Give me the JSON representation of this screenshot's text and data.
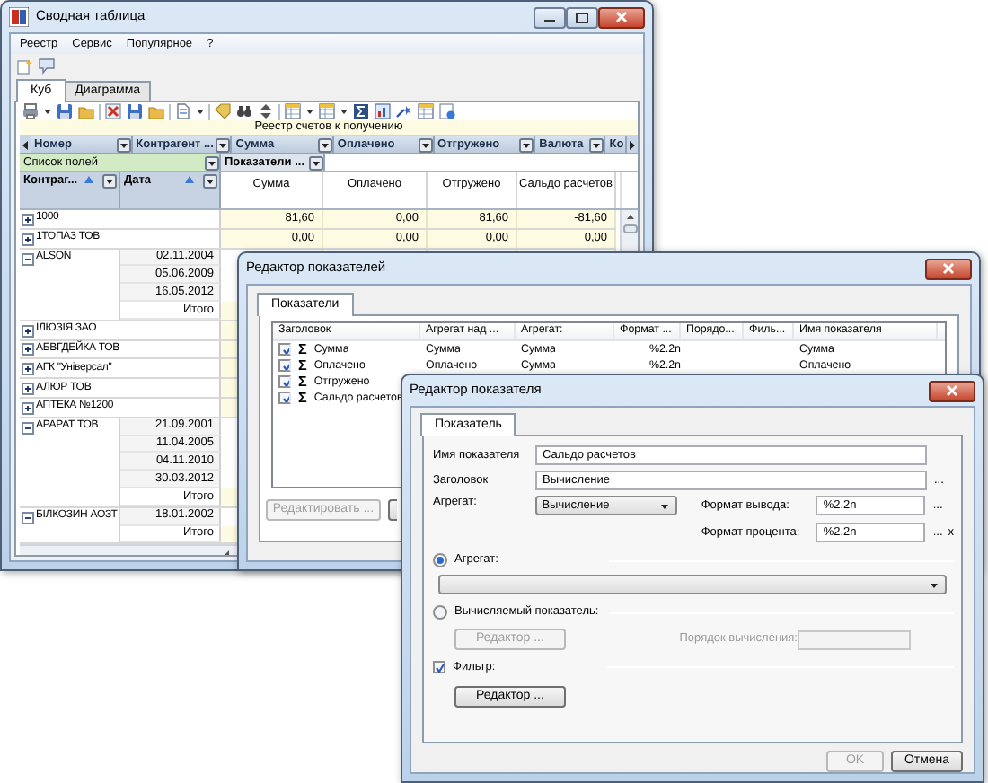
{
  "main_window": {
    "title": "Сводная таблица",
    "menu": [
      "Реестр",
      "Сервис",
      "Популярное",
      "?"
    ],
    "tabs": [
      {
        "label": "Куб",
        "selected": true
      },
      {
        "label": "Диаграмма",
        "selected": false
      }
    ],
    "pivot": {
      "banner": "Реестр счетов к получению",
      "column_fields": [
        "Номер",
        "Контрагент ...",
        "Сумма",
        "Оплачено",
        "Отгружено",
        "Валюта",
        "Ко"
      ],
      "field_list": "Список полей",
      "measures": "Показатели ...",
      "row_fields": [
        "Контраг...",
        "Дата"
      ],
      "columns": [
        "Сумма",
        "Оплачено",
        "Отгружено",
        "Сальдо расчетов"
      ],
      "rows": [
        {
          "label": "1000",
          "expanded": false,
          "values": [
            "81,60",
            "0,00",
            "81,60",
            "-81,60"
          ]
        },
        {
          "label": "1ТОПАЗ ТОВ",
          "expanded": false,
          "values": [
            "0,00",
            "0,00",
            "0,00",
            "0,00"
          ]
        },
        {
          "label": "ALSON",
          "expanded": true,
          "children": [
            {
              "label": "02.11.2004",
              "kind": "date"
            },
            {
              "label": "05.06.2009",
              "kind": "date"
            },
            {
              "label": "16.05.2012",
              "kind": "date"
            },
            {
              "label": "Итого",
              "kind": "total"
            }
          ]
        },
        {
          "label": "ІЛЮЗІЯ ЗАО",
          "expanded": false
        },
        {
          "label": "АБВГДЕЙКА ТОВ",
          "expanded": false
        },
        {
          "label": "АГК \"Універсал\"",
          "expanded": false
        },
        {
          "label": "АЛЮР ТОВ",
          "expanded": false
        },
        {
          "label": "АПТЕКА №1200",
          "expanded": false
        },
        {
          "label": "АРАРАТ ТОВ",
          "expanded": true,
          "children": [
            {
              "label": "21.09.2001",
              "kind": "date"
            },
            {
              "label": "11.04.2005",
              "kind": "date"
            },
            {
              "label": "04.11.2010",
              "kind": "date"
            },
            {
              "label": "30.03.2012",
              "kind": "date"
            },
            {
              "label": "Итого",
              "kind": "total"
            }
          ]
        },
        {
          "label": "БІЛКОЗИН АОЗТ",
          "expanded": true,
          "children": [
            {
              "label": "18.01.2002",
              "kind": "date"
            },
            {
              "label": "Итого",
              "kind": "total"
            }
          ]
        }
      ]
    }
  },
  "measures_editor": {
    "title": "Редактор показателей",
    "tabs": [
      {
        "label": "Показатели",
        "selected": true
      }
    ],
    "columns": [
      "Заголовок",
      "Агрегат над ...",
      "Агрегат:",
      "Формат ...",
      "Порядо...",
      "Филь...",
      "Имя показателя"
    ],
    "rows": [
      {
        "checked": true,
        "symbol": "Σ",
        "cells": [
          "Сумма",
          "Сумма",
          "Сумма",
          "%2.2n",
          "",
          "",
          "Сумма"
        ]
      },
      {
        "checked": true,
        "symbol": "Σ",
        "cells": [
          "Оплачено",
          "Оплачено",
          "Сумма",
          "%2.2n",
          "",
          "",
          "Оплачено"
        ]
      },
      {
        "checked": true,
        "symbol": "Σ",
        "cells": [
          "Отгружено"
        ]
      },
      {
        "checked": true,
        "symbol": "Σ",
        "cells": [
          "Сальдо расчетов"
        ]
      }
    ],
    "buttons": [
      {
        "label": "Редактировать ...",
        "disabled": true
      }
    ]
  },
  "measure_editor": {
    "title": "Редактор показателя",
    "tabs": [
      {
        "label": "Показатель",
        "selected": true
      }
    ],
    "name_field": {
      "label": "Имя показателя",
      "value": "Сальдо расчетов"
    },
    "caption_field": {
      "label": "Заголовок",
      "value": "Вычисление",
      "button": "..."
    },
    "aggregate_select": {
      "label": "Агрегат:",
      "value": "Вычисление"
    },
    "output_format": {
      "label": "Формат вывода:",
      "value": "%2.2n",
      "button": "..."
    },
    "percent_format": {
      "label": "Формат процента:",
      "value": "%2.2n",
      "button": "...",
      "clear": "x"
    },
    "aggregate_option": {
      "label": "Агрегат:",
      "selected": true
    },
    "computed_option": {
      "label": "Вычисляемый показатель:",
      "selected": false
    },
    "computed_editor_button": {
      "label": "Редактор ...",
      "disabled": true
    },
    "order_field": {
      "label": "Порядок вычисления:",
      "disabled": true
    },
    "filter_option": {
      "label": "Фильтр:",
      "checked": true
    },
    "filter_editor_button": {
      "label": "Редактор ...",
      "disabled": false
    },
    "buttons": [
      {
        "label": "OK",
        "disabled": true
      },
      {
        "label": "Отмена",
        "disabled": false
      }
    ]
  }
}
